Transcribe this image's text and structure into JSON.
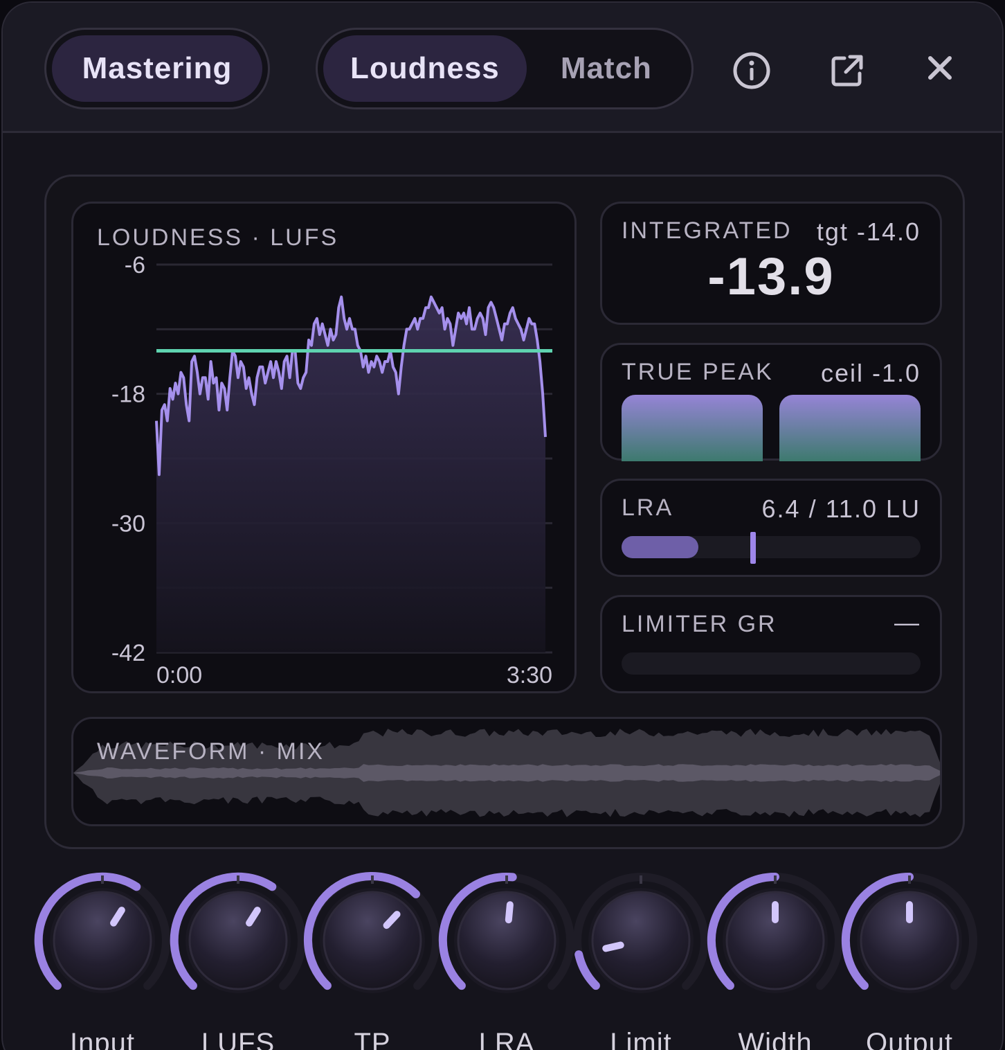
{
  "header": {
    "mode_tabs": [
      {
        "label": "Mastering",
        "active": true
      }
    ],
    "view_tabs": [
      {
        "label": "Loudness",
        "active": true
      },
      {
        "label": "Match",
        "active": false
      }
    ],
    "icons": [
      "info-icon",
      "external-link-icon",
      "close-icon"
    ]
  },
  "loudness_graph": {
    "title": "LOUDNESS · LUFS",
    "y_ticks": [
      "-6",
      "-18",
      "-30",
      "-42"
    ],
    "x_start": "0:00",
    "x_end": "3:30"
  },
  "integrated": {
    "label": "INTEGRATED",
    "target": "tgt -14.0",
    "value": "-13.9"
  },
  "true_peak": {
    "label": "TRUE PEAK",
    "ceiling": "ceil -1.0"
  },
  "lra": {
    "label": "LRA",
    "value": "6.4 / 11.0 LU",
    "current": 6.4,
    "max": 11.0
  },
  "limiter": {
    "label": "LIMITER GR",
    "value": "—"
  },
  "waveform": {
    "label": "WAVEFORM · MIX"
  },
  "knobs": [
    {
      "label": "Input",
      "value": 0.62
    },
    {
      "label": "LUFS",
      "value": 0.62
    },
    {
      "label": "TP",
      "value": 0.66
    },
    {
      "label": "LRA",
      "value": 0.52
    },
    {
      "label": "Limit",
      "value": 0.12
    },
    {
      "label": "Width",
      "value": 0.5
    },
    {
      "label": "Output",
      "value": 0.5
    }
  ],
  "colors": {
    "accent": "#a590ec",
    "target_line": "#5fd3b0",
    "panel": "#141319",
    "card": "#0e0d13"
  },
  "chart_data": {
    "type": "line",
    "title": "LOUDNESS · LUFS",
    "xlabel": "",
    "ylabel": "",
    "x_range": [
      "0:00",
      "3:30"
    ],
    "ylim": [
      -42,
      -6
    ],
    "target": -14.0,
    "series": [
      {
        "values": [
          -20.5,
          -25.5,
          -19.5,
          -19,
          -20.5,
          -17.5,
          -18.5,
          -17,
          -18,
          -16,
          -16.5,
          -19,
          -20.5,
          -15,
          -14.5,
          -16,
          -18,
          -16.5,
          -16.5,
          -18.5,
          -15,
          -17,
          -16.5,
          -19.5,
          -17,
          -17.5,
          -19.5,
          -16.5,
          -14,
          -14.5,
          -16.5,
          -15,
          -15.5,
          -17.5,
          -16.5,
          -18,
          -19,
          -16.5,
          -15.5,
          -15.5,
          -17,
          -16,
          -15,
          -16.5,
          -15,
          -16,
          -17.5,
          -15,
          -14.5,
          -16.5,
          -14,
          -14,
          -17,
          -17.5,
          -16.5,
          -16,
          -13,
          -13.5,
          -11.5,
          -11,
          -12.5,
          -11.5,
          -12.5,
          -13.5,
          -12,
          -13,
          -12.5,
          -10,
          -9,
          -11,
          -12,
          -11,
          -12,
          -12,
          -13.5,
          -14,
          -15.5,
          -14.5,
          -16,
          -15,
          -15.5,
          -14.5,
          -15,
          -16,
          -15,
          -15,
          -14,
          -15.5,
          -16,
          -18,
          -15.5,
          -13.5,
          -12,
          -12,
          -11.5,
          -11,
          -12,
          -11,
          -11,
          -10,
          -10,
          -9,
          -9.5,
          -10,
          -10.5,
          -10,
          -12,
          -11,
          -11.5,
          -13.5,
          -12,
          -10.5,
          -11,
          -10.5,
          -11.5,
          -10,
          -12,
          -12,
          -11,
          -10.5,
          -11,
          -12.5,
          -10,
          -9.5,
          -10,
          -11,
          -12,
          -13,
          -11.5,
          -11.5,
          -10.5,
          -10,
          -11,
          -11.5,
          -12,
          -13,
          -12,
          -11,
          -11.5,
          -11.5,
          -13,
          -15,
          -18,
          -22
        ]
      }
    ]
  }
}
